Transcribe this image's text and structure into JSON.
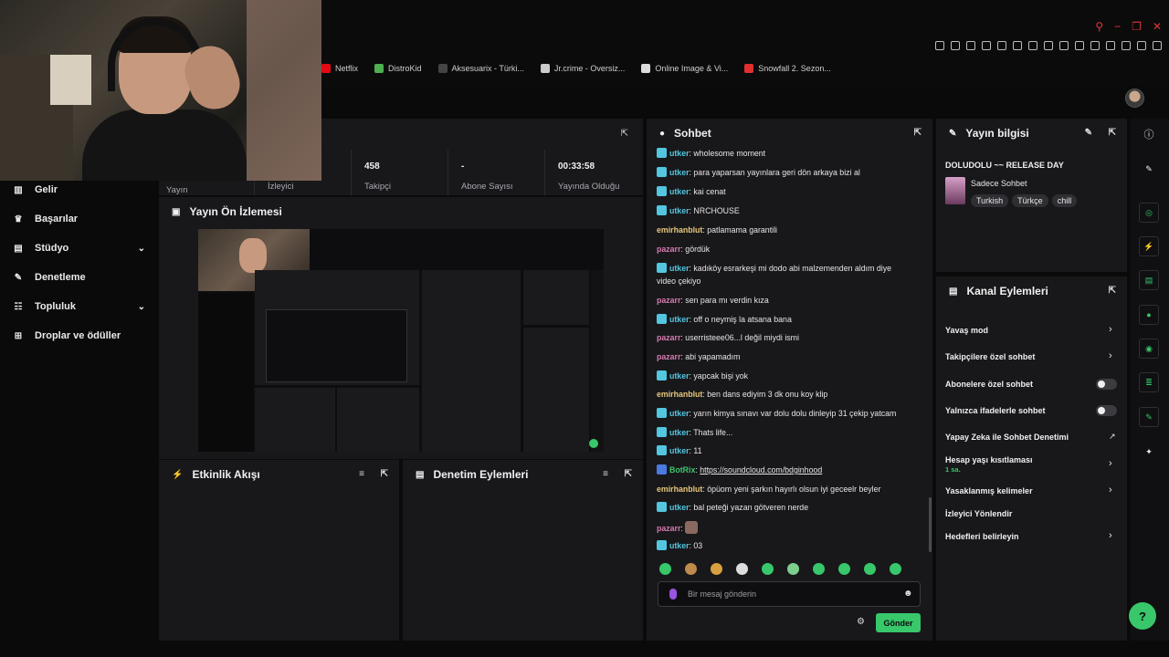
{
  "browser": {
    "bookmarks": [
      {
        "label": "Netflix",
        "color": "#e50914"
      },
      {
        "label": "DistroKid",
        "color": "#4caf50"
      },
      {
        "label": "Aksesuarix - Türki...",
        "color": "#444444"
      },
      {
        "label": "Jr.crime - Oversiz...",
        "color": "#cccccc"
      },
      {
        "label": "Online Image & Vi...",
        "color": "#dddddd"
      },
      {
        "label": "Snowfall 2. Sezon...",
        "color": "#e03030"
      }
    ]
  },
  "nav": {
    "items": [
      {
        "label": "Gelir",
        "icon": "chart-icon",
        "expandable": false
      },
      {
        "label": "Başarılar",
        "icon": "trophy-icon",
        "expandable": false
      },
      {
        "label": "Stüdyo",
        "icon": "studio-icon",
        "expandable": true
      },
      {
        "label": "Denetleme",
        "icon": "sword-icon",
        "expandable": false
      },
      {
        "label": "Topluluk",
        "icon": "community-icon",
        "expandable": true
      },
      {
        "label": "Droplar ve ödüller",
        "icon": "gift-icon",
        "expandable": false
      }
    ]
  },
  "stats": {
    "items": [
      {
        "value": "",
        "label": "Yayın"
      },
      {
        "value": "",
        "label": "İzleyici"
      },
      {
        "value": "458",
        "label": "Takipçi"
      },
      {
        "value": "-",
        "label": "Abone Sayısı"
      },
      {
        "value": "00:33:58",
        "label": "Yayında Olduğu"
      }
    ]
  },
  "preview": {
    "title": "Yayın Ön İzlemesi"
  },
  "activity": {
    "title": "Etkinlik Akışı"
  },
  "modactions": {
    "title": "Denetim Eylemleri"
  },
  "chat": {
    "title": "Sohbet",
    "messages": [
      {
        "user": "utker",
        "text": "wholesome moment",
        "color": "#53c6e0",
        "badge": true
      },
      {
        "user": "utker",
        "text": "para yaparsan yayınlara geri dön arkaya bizi al",
        "color": "#53c6e0",
        "badge": true
      },
      {
        "user": "utker",
        "text": "kai cenat",
        "color": "#53c6e0",
        "badge": true
      },
      {
        "user": "utker",
        "text": "NRCHOUSE",
        "color": "#53c6e0",
        "badge": true
      },
      {
        "user": "emirhanblut",
        "text": "patlamama garantili",
        "color": "#e8c77a",
        "badge": false
      },
      {
        "user": "pazarr",
        "text": "gördük",
        "color": "#d77ab0",
        "badge": false
      },
      {
        "user": "utker",
        "text": "kadıköy esrarkeşi mi dodo abi malzemenden aldım diye",
        "color": "#53c6e0",
        "badge": true
      },
      {
        "user": "",
        "text": "video çekiyo",
        "color": "#53c6e0",
        "badge": false
      },
      {
        "user": "pazarr",
        "text": "sen para mı verdin kıza",
        "color": "#d77ab0",
        "badge": false
      },
      {
        "user": "utker",
        "text": "off o neymiş la atsana bana",
        "color": "#53c6e0",
        "badge": true
      },
      {
        "user": "pazarr",
        "text": "userristeee06...l değil miydi ismi",
        "color": "#d77ab0",
        "badge": false
      },
      {
        "user": "pazarr",
        "text": "abi yapamadım",
        "color": "#d77ab0",
        "badge": false
      },
      {
        "user": "utker",
        "text": "yapcak bişi yok",
        "color": "#53c6e0",
        "badge": true
      },
      {
        "user": "emirhanblut",
        "text": "ben dans ediyim 3 dk onu koy klip",
        "color": "#e8c77a",
        "badge": false
      },
      {
        "user": "utker",
        "text": "yarın kimya sınavı var dolu dolu dinleyip 31 çekip yatcam",
        "color": "#53c6e0",
        "badge": true
      },
      {
        "user": "utker",
        "text": "Thats life...",
        "color": "#53c6e0",
        "badge": true
      },
      {
        "user": "utker",
        "text": "11",
        "color": "#53c6e0",
        "badge": true
      },
      {
        "user": "BotRix",
        "text": "https://soundcloud.com/bdginhood",
        "color": "#38c76a",
        "badge": true,
        "link": true
      },
      {
        "user": "emirhanblut",
        "text": "öpüom yeni şarkın hayırlı olsun iyi geceelr beyler",
        "color": "#e8c77a",
        "badge": false
      },
      {
        "user": "utker",
        "text": "bal peteği yazan götveren nerde",
        "color": "#53c6e0",
        "badge": true
      },
      {
        "user": "pazarr",
        "text": "",
        "color": "#d77ab0",
        "badge": false,
        "emote": true
      },
      {
        "user": "utker",
        "text": "03",
        "color": "#53c6e0",
        "badge": true
      }
    ],
    "input_placeholder": "Bir mesaj gönderin",
    "send_label": "Gönder"
  },
  "stream_info": {
    "title": "Yayın bilgisi",
    "stream_title": "DOLUDOLU ~~ RELEASE DAY",
    "category": "Sadece Sohbet",
    "tags": [
      "Turkish",
      "Türkçe",
      "chill"
    ]
  },
  "channel_actions": {
    "title": "Kanal Eylemleri",
    "items": [
      {
        "label": "Yavaş mod",
        "control": "chevron"
      },
      {
        "label": "Takipçilere özel sohbet",
        "control": "chevron"
      },
      {
        "label": "Abonelere özel sohbet",
        "control": "toggle"
      },
      {
        "label": "Yalnızca ifadelerle sohbet",
        "control": "toggle"
      },
      {
        "label": "Yapay Zeka ile Sohbet Denetimi",
        "control": "external"
      },
      {
        "label": "Hesap yaşı kısıtlaması",
        "sub": "1 sa.",
        "control": "chevron"
      },
      {
        "label": "Yasaklanmış kelimeler",
        "control": "chevron"
      },
      {
        "label": "İzleyici Yönlendir",
        "control": "none"
      },
      {
        "label": "Hedefleri belirleyin",
        "control": "chevron"
      }
    ]
  },
  "colors": {
    "accent": "#38c76a",
    "panel": "#18181b",
    "background": "#0a0a0a"
  }
}
